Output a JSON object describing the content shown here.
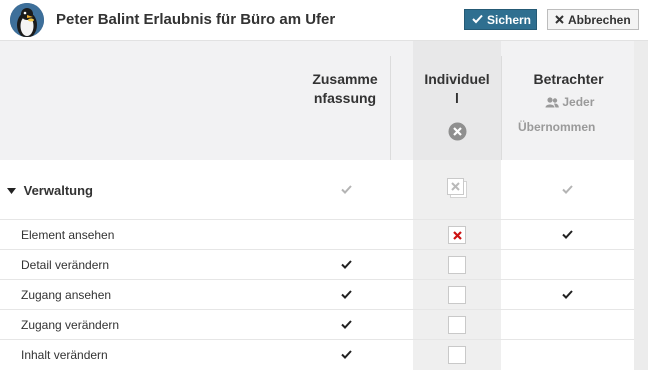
{
  "header": {
    "title": "Peter Balint Erlaubnis für Büro am Ufer",
    "save_label": "Sichern",
    "cancel_label": "Abbrechen"
  },
  "columns": {
    "summary_line1": "Zusamme",
    "summary_line2": "nfassung",
    "individual_line1": "Individuel",
    "individual_line2": "l",
    "viewer": "Betrachter",
    "viewer_scope": "Jeder",
    "viewer_inherited": "Übernommen"
  },
  "group": {
    "label": "Verwaltung"
  },
  "rows": [
    {
      "label": "Element ansehen"
    },
    {
      "label": "Detail verändern"
    },
    {
      "label": "Zugang ansehen"
    },
    {
      "label": "Zugang verändern"
    },
    {
      "label": "Inhalt verändern"
    }
  ],
  "colors": {
    "save": "#2f6f90",
    "deny": "#cc1111",
    "header_bg": "#f2f2f3"
  }
}
